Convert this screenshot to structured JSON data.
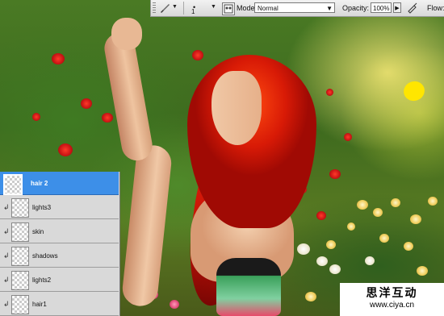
{
  "options_bar": {
    "tool_icon": "brush-icon",
    "brush_size": "1",
    "mode_label": "Mode:",
    "mode_value": "Normal",
    "opacity_label": "Opacity:",
    "opacity_value": "100%",
    "flow_label": "Flow:"
  },
  "layers_panel": {
    "layers": [
      {
        "name": "hair 2",
        "selected": true
      },
      {
        "name": "lights3",
        "selected": false
      },
      {
        "name": "skin",
        "selected": false
      },
      {
        "name": "shadows",
        "selected": false
      },
      {
        "name": "lights2",
        "selected": false
      },
      {
        "name": "hair1",
        "selected": false
      }
    ]
  },
  "watermark": {
    "chinese": "思洋互动",
    "url": "www.ciya.cn"
  },
  "colors": {
    "selected_layer": "#3d8fe8",
    "sun_marker": "#ffe600",
    "hair": "#d81a06"
  }
}
